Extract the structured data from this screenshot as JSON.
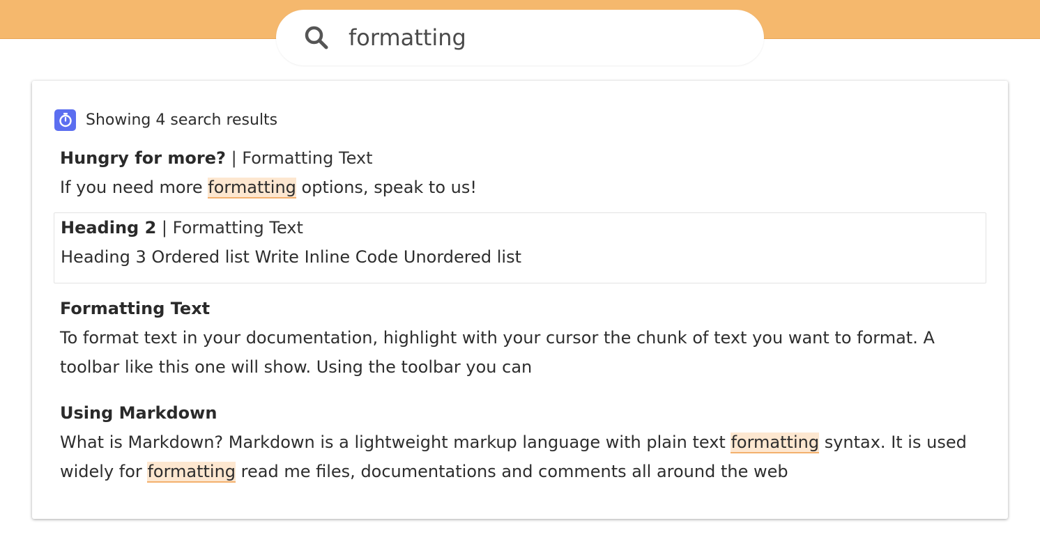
{
  "search": {
    "query": "formatting"
  },
  "results_header": {
    "label": "Showing 4 search results",
    "icon": "stopwatch-icon"
  },
  "results": [
    {
      "title": "Hungry for more?",
      "separator": " | ",
      "section": "Formatting Text",
      "snippet": [
        "If you need more ",
        "formatting",
        " options, speak to us!"
      ]
    },
    {
      "title": "Heading 2",
      "separator": " | ",
      "section": "Formatting Text",
      "snippet": [
        "Heading 3 Ordered list Write Inline Code Unordered list"
      ]
    },
    {
      "title": "Formatting Text",
      "snippet": [
        "To format text in your documentation, highlight with your cursor the chunk of text you want to format. A toolbar like this one will show. Using the toolbar you can"
      ]
    },
    {
      "title": "Using Markdown",
      "snippet": [
        "What is Markdown? Markdown is a lightweight markup language with plain text ",
        "formatting",
        " syntax. It is used widely for ",
        "formatting",
        " read me files, documentations and comments all around the web"
      ]
    }
  ],
  "colors": {
    "top_band": "#f5b86d",
    "badge": "#5b6ef0",
    "highlight_bg": "#fde7d0",
    "highlight_underline": "#f3b06d"
  }
}
